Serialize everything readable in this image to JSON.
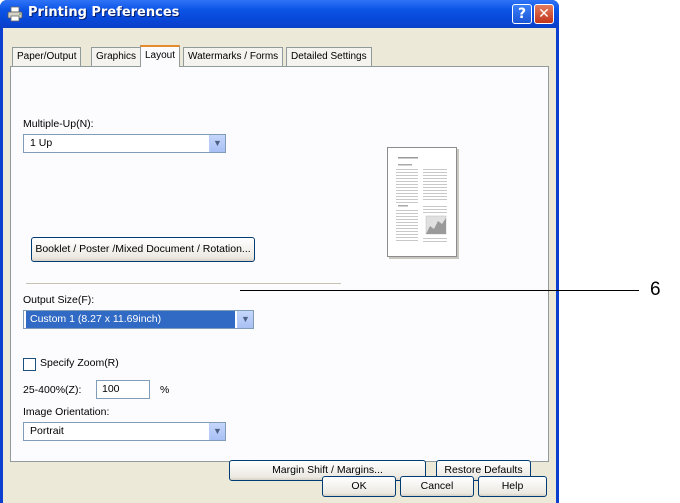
{
  "window": {
    "title": "Printing Preferences",
    "help_button": "?",
    "close_button": "✕"
  },
  "tabs": [
    {
      "label": "Paper/Output",
      "active": false
    },
    {
      "label": "Graphics",
      "active": false
    },
    {
      "label": "Layout",
      "active": true
    },
    {
      "label": "Watermarks / Forms",
      "active": false
    },
    {
      "label": "Detailed Settings",
      "active": false
    }
  ],
  "layout": {
    "multiple_up_label": "Multiple-Up(N):",
    "multiple_up_value": "1 Up",
    "booklet_button": "Booklet / Poster /Mixed Document / Rotation...",
    "output_size_label": "Output Size(F):",
    "output_size_value": "Custom 1 (8.27 x 11.69inch)",
    "specify_zoom_label": "Specify Zoom(R)",
    "specify_zoom_checked": false,
    "zoom_range_label": "25-400%(Z):",
    "zoom_value": "100",
    "zoom_unit": "%",
    "orientation_label": "Image Orientation:",
    "orientation_value": "Portrait",
    "margin_button": "Margin Shift / Margins...",
    "restore_button": "Restore Defaults"
  },
  "footer": {
    "ok_button": "OK",
    "cancel_button": "Cancel",
    "help_button": "Help"
  },
  "callout": {
    "number": "6"
  },
  "colors": {
    "title_bar": "#0b54e6",
    "dialog_face": "#ece9d8",
    "selection": "#316ac5",
    "active_tab_accent": "#e68b2c"
  }
}
